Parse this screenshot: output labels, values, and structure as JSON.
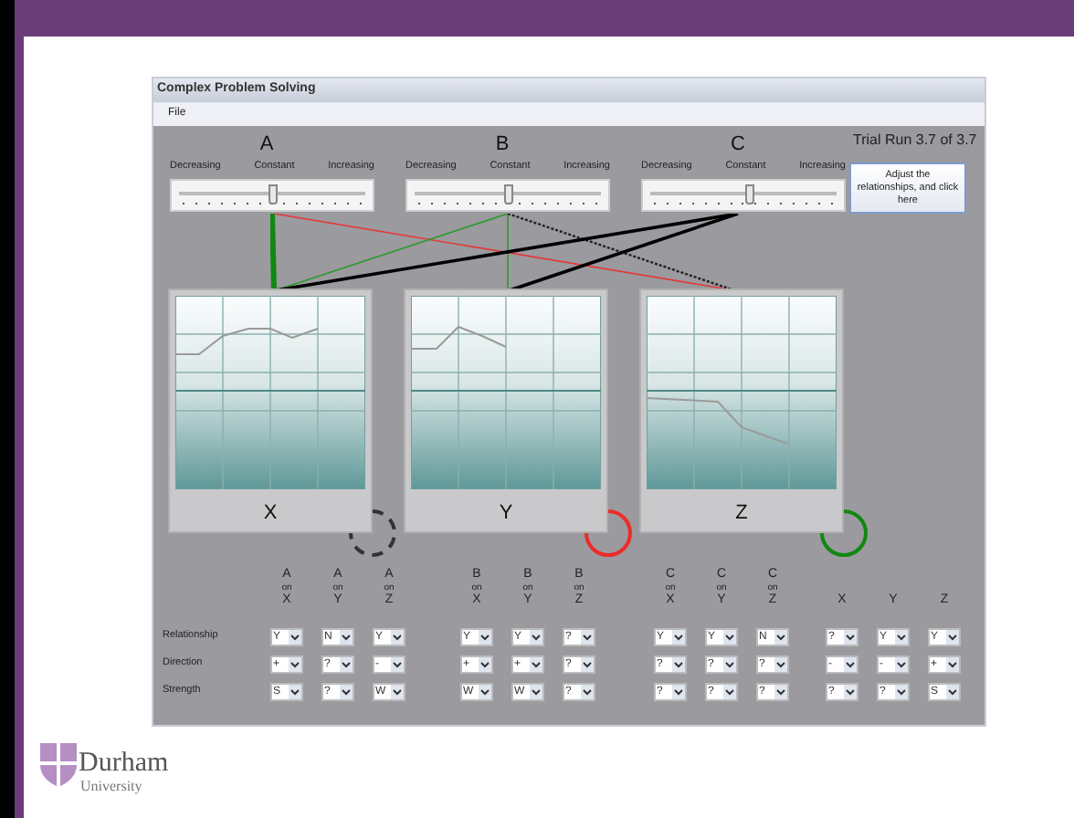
{
  "window": {
    "title": "Complex Problem Solving"
  },
  "menu": [
    {
      "label": "File"
    }
  ],
  "trial_run": "Trial Run 3.7 of 3.7",
  "sliders": [
    {
      "name": "A",
      "labels": [
        "Decreasing",
        "Constant",
        "Increasing"
      ],
      "level": 0.5
    },
    {
      "name": "B",
      "labels": [
        "Decreasing",
        "Constant",
        "Increasing"
      ],
      "level": 0.5
    },
    {
      "name": "C",
      "labels": [
        "Decreasing",
        "Constant",
        "Increasing"
      ],
      "level": 0.53
    }
  ],
  "action_button": "Adjust the relationships, and click here",
  "charts": [
    {
      "label": "X",
      "ring": {
        "kind": "dashed",
        "color": "#333333"
      }
    },
    {
      "label": "Y",
      "ring": {
        "kind": "solid",
        "color": "#ee2a2a"
      }
    },
    {
      "label": "Z",
      "ring": {
        "kind": "solid",
        "color": "#118811"
      }
    }
  ],
  "relationship_table": {
    "columns": [
      {
        "top": "A",
        "middle": "on",
        "bottom": "X"
      },
      {
        "top": "A",
        "middle": "on",
        "bottom": "Y"
      },
      {
        "top": "A",
        "middle": "on",
        "bottom": "Z"
      },
      {
        "top": "B",
        "middle": "on",
        "bottom": "X"
      },
      {
        "top": "B",
        "middle": "on",
        "bottom": "Y"
      },
      {
        "top": "B",
        "middle": "on",
        "bottom": "Z"
      },
      {
        "top": "C",
        "middle": "on",
        "bottom": "X"
      },
      {
        "top": "C",
        "middle": "on",
        "bottom": "Y"
      },
      {
        "top": "C",
        "middle": "on",
        "bottom": "Z"
      },
      {
        "bottom": "X"
      },
      {
        "bottom": "Y"
      },
      {
        "bottom": "Z"
      }
    ],
    "rows": [
      {
        "label": "Relationship",
        "values": [
          "Y",
          "N",
          "Y",
          "Y",
          "Y",
          "?",
          "Y",
          "Y",
          "N",
          "?",
          "Y",
          "Y"
        ]
      },
      {
        "label": "Direction",
        "values": [
          "+",
          "?",
          "-",
          "+",
          "+",
          "?",
          "?",
          "?",
          "?",
          "-",
          "-",
          "+"
        ]
      },
      {
        "label": "Strength",
        "values": [
          "S",
          "?",
          "W",
          "W",
          "W",
          "?",
          "?",
          "?",
          "?",
          "?",
          "?",
          "S"
        ]
      }
    ]
  },
  "logo": {
    "name": "Durham",
    "subtitle": "University"
  }
}
